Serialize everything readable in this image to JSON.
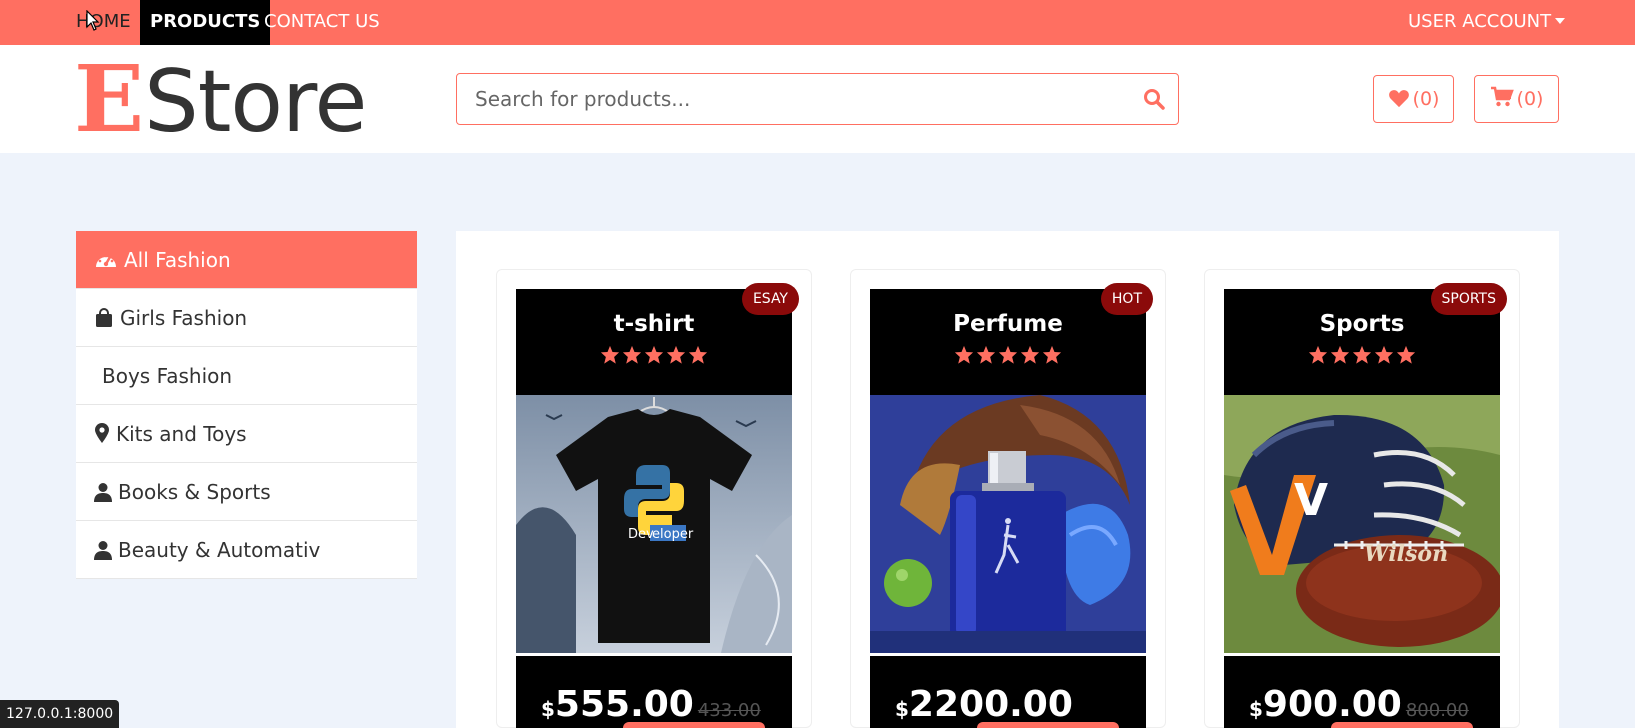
{
  "nav": {
    "home": "HOME",
    "products": "PRODUCTS",
    "contact": "CONTACT US",
    "account": "USER ACCOUNT"
  },
  "header": {
    "logo_first": "E",
    "logo_rest": "Store",
    "search_placeholder": "Search for products...",
    "wishlist_count": "(0)",
    "cart_count": "(0)"
  },
  "sidebar": {
    "items": [
      {
        "label": "All Fashion",
        "icon": "dashboard-icon",
        "active": true
      },
      {
        "label": "Girls Fashion",
        "icon": "shopping-bag-icon"
      },
      {
        "label": "Boys Fashion",
        "icon": ""
      },
      {
        "label": "Kits and Toys",
        "icon": "map-marker-icon"
      },
      {
        "label": "Books & Sports",
        "icon": "user-icon"
      },
      {
        "label": "Beauty & Automativ",
        "icon": "user-icon"
      }
    ]
  },
  "products": [
    {
      "title": "t-shirt",
      "badge": "ESAY",
      "rating": 5,
      "currency": "$",
      "price": "555.00",
      "old_price": "433.00",
      "image": "python-developer-tshirt",
      "shirt_text_a": "Dev",
      "shirt_text_b": "eloper"
    },
    {
      "title": "Perfume",
      "badge": "HOT",
      "rating": 5,
      "currency": "$",
      "price": "2200.00",
      "old_price": "",
      "image": "blue-perfume-bottle"
    },
    {
      "title": "Sports",
      "badge": "SPORTS",
      "rating": 5,
      "currency": "$",
      "price": "900.00",
      "old_price": "800.00",
      "image": "football-helmet-and-ball",
      "helmet_letter": "V",
      "ball_brand": "Wilson"
    }
  ],
  "status_url": "127.0.0.1:8000",
  "colors": {
    "accent": "#ff6f61",
    "dark": "#000000",
    "badge": "#8b0a0a",
    "page_bg": "#eef3fb"
  }
}
